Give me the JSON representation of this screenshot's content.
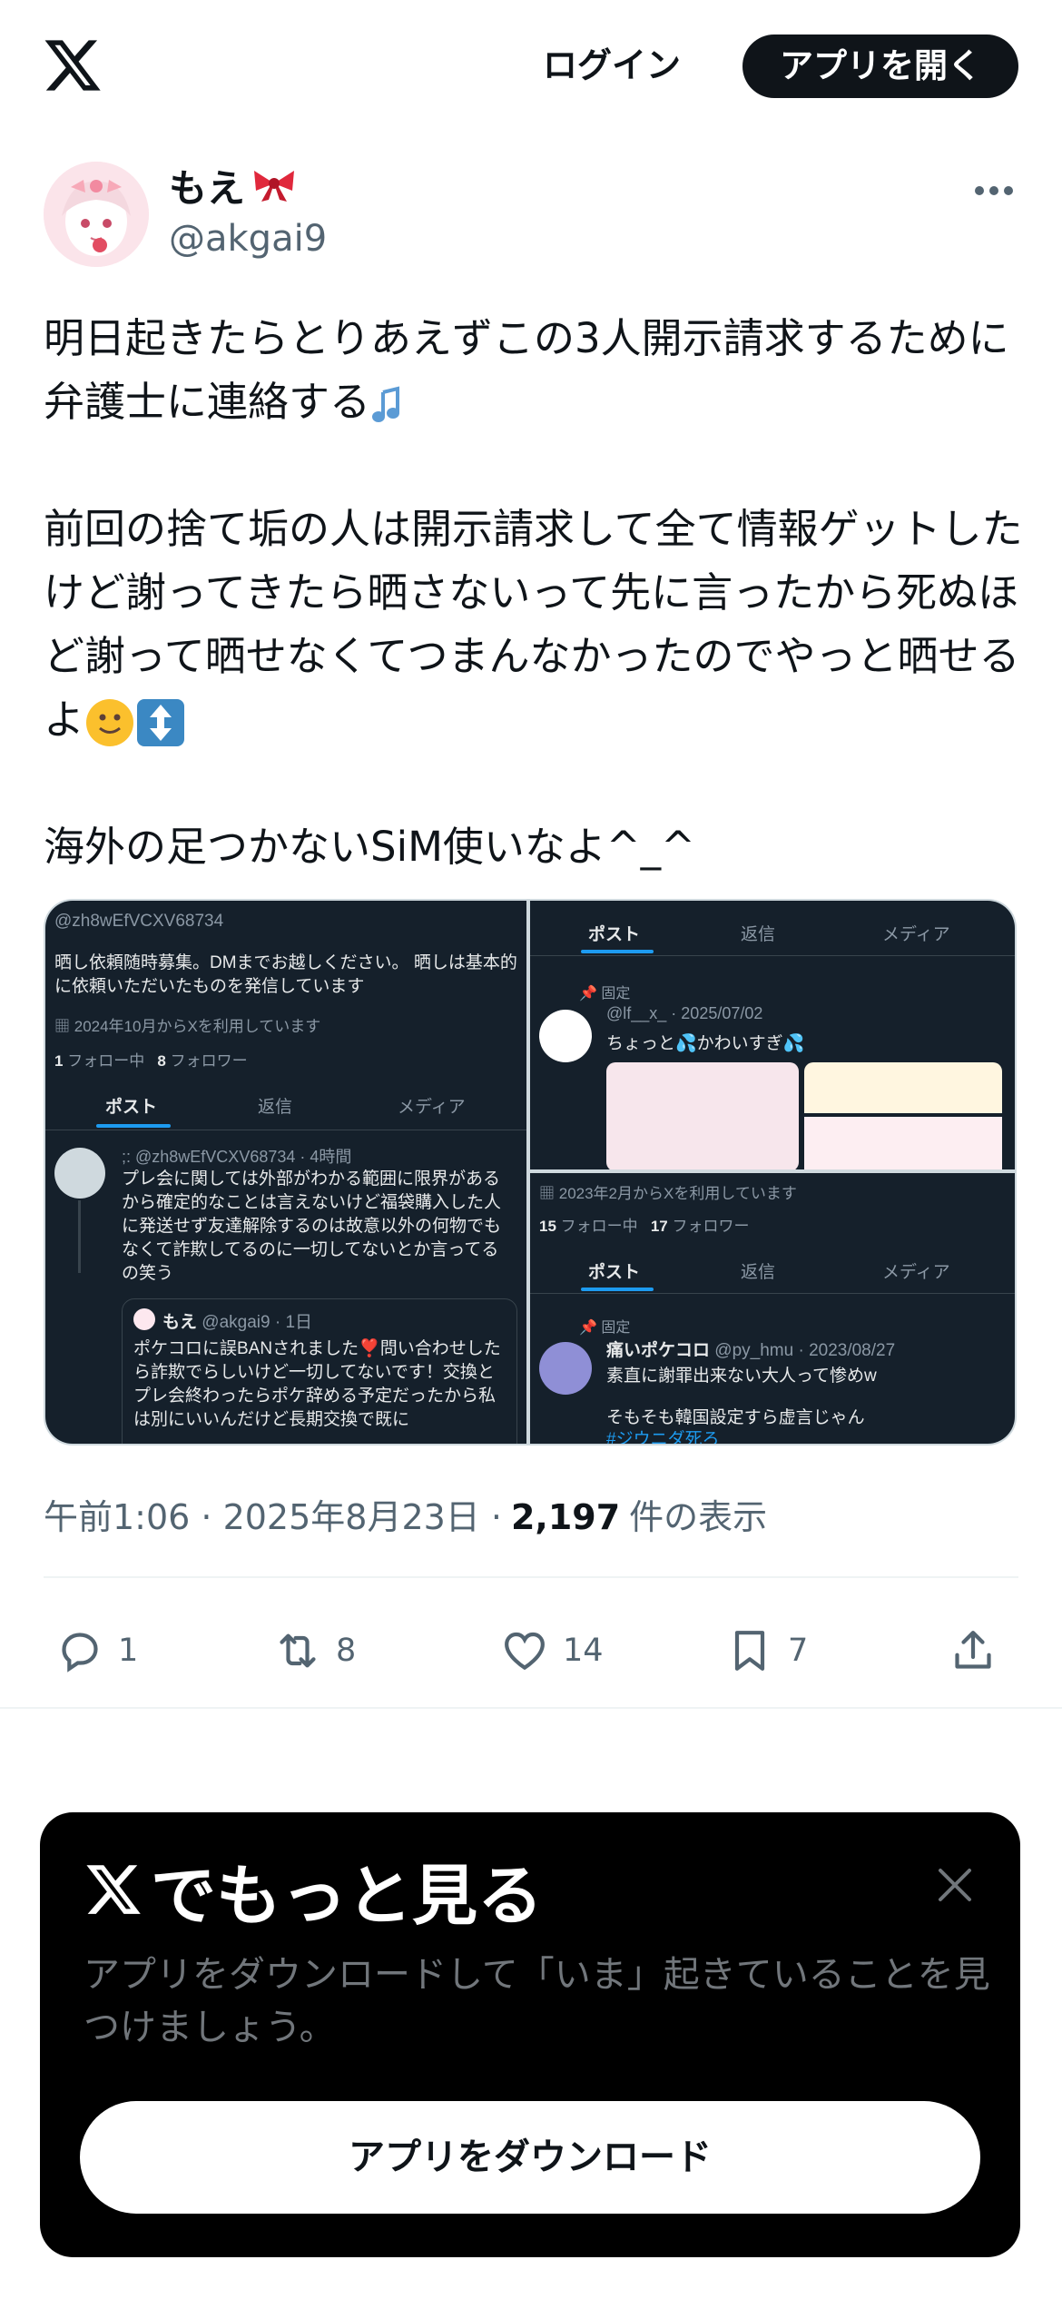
{
  "header": {
    "logo_icon": "x-logo-icon",
    "login_label": "ログイン",
    "open_app_label": "アプリを開く"
  },
  "post": {
    "author": {
      "display_name": "もえ",
      "name_emoji": "ribbon-icon",
      "handle": "@akgai9"
    },
    "paragraphs": [
      "明日起きたらとりあえずこの3人開示請求するために弁護士に連絡する",
      "前回の捨て垢の人は開示請求して全て情報ゲットしたけど謝ってきたら晒さないって先に言ったから死ぬほど謝って晒せなくてつまんなかったのでやっと晒せるよ",
      "海外の足つかないSiM使いなよ^_^"
    ],
    "timestamp": "午前1:06 · 2025年8月23日 ·",
    "views_count": "2,197",
    "views_label": "件の表示",
    "stats": {
      "replies": "1",
      "reposts": "8",
      "likes": "14",
      "bookmarks": "7"
    }
  },
  "media": {
    "left": {
      "handle": "@zh8wEfVCXV68734",
      "bio": "晒し依頼随時募集。DMまでお越しください。 晒しは基本的に依頼いただいたものを発信しています",
      "joined": "2024年10月からXを利用しています",
      "following_count": "1",
      "following_label": "フォロー中",
      "followers_count": "8",
      "followers_label": "フォロワー",
      "tabs": [
        "ポスト",
        "返信",
        "メディア"
      ],
      "tweet_meta": ";: @zh8wEfVCXV68734 · 4時間",
      "tweet_text": "プレ会に関しては外部がわかる範囲に限界があるから確定的なことは言えないけど福袋購入した人に発送せず友達解除するのは故意以外の何物でもなくて詐欺してるのに一切してないとか言ってるの笑う",
      "quote_name": "もえ",
      "quote_meta": "@akgai9 · 1日",
      "quote_text": "ポケコロに誤BANされました❣️問い合わせしたら詐欺でらしいけど一切してないです！交換とプレ会終わったらポケ辞める予定だったから私は別にいいんだけど長期交換で既に"
    },
    "right_top": {
      "tabs": [
        "ポスト",
        "返信",
        "メディア"
      ],
      "pinned_label": "固定",
      "tweet_meta": "@lf__x_ · 2025/07/02",
      "tweet_text": "ちょっと💦かわいすぎ💦"
    },
    "right_bottom": {
      "joined": "2023年2月からXを利用しています",
      "following_count": "15",
      "following_label": "フォロー中",
      "followers_count": "17",
      "followers_label": "フォロワー",
      "tabs": [
        "ポスト",
        "返信",
        "メディア"
      ],
      "pinned_label": "固定",
      "tweet_name": "痛いポケコロ",
      "tweet_meta": "@py_hmu · 2023/08/27",
      "tweet_line1": "素直に謝罪出来ない大人って惨めw",
      "tweet_line2": "そもそも韓国設定すら虚言じゃん",
      "tweet_hashtag": "#ジウニダ死ろ"
    }
  },
  "promo": {
    "title": "でもっと見る",
    "description": "アプリをダウンロードして「いま」起きていることを見つけましょう。",
    "download_label": "アプリをダウンロード"
  },
  "colors": {
    "text": "#0f1419",
    "muted": "#536471",
    "accent": "#1d9bf0",
    "dark_panel": "#15202b"
  }
}
